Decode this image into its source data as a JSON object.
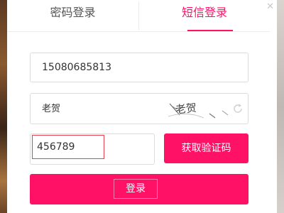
{
  "tabs": {
    "password_login": "密码登录",
    "sms_login": "短信登录",
    "active": "sms_login"
  },
  "form": {
    "phone_value": "15080685813",
    "captcha_input_value": "老贺",
    "captcha_image_text": "老贺",
    "sms_code_value": "456789",
    "get_code_label": "获取验证码",
    "login_label": "登录"
  },
  "colors": {
    "accent": "#ff1166",
    "code_box_border": "#e84050"
  },
  "icons": {
    "refresh": "refresh-icon",
    "close": "close-icon"
  }
}
